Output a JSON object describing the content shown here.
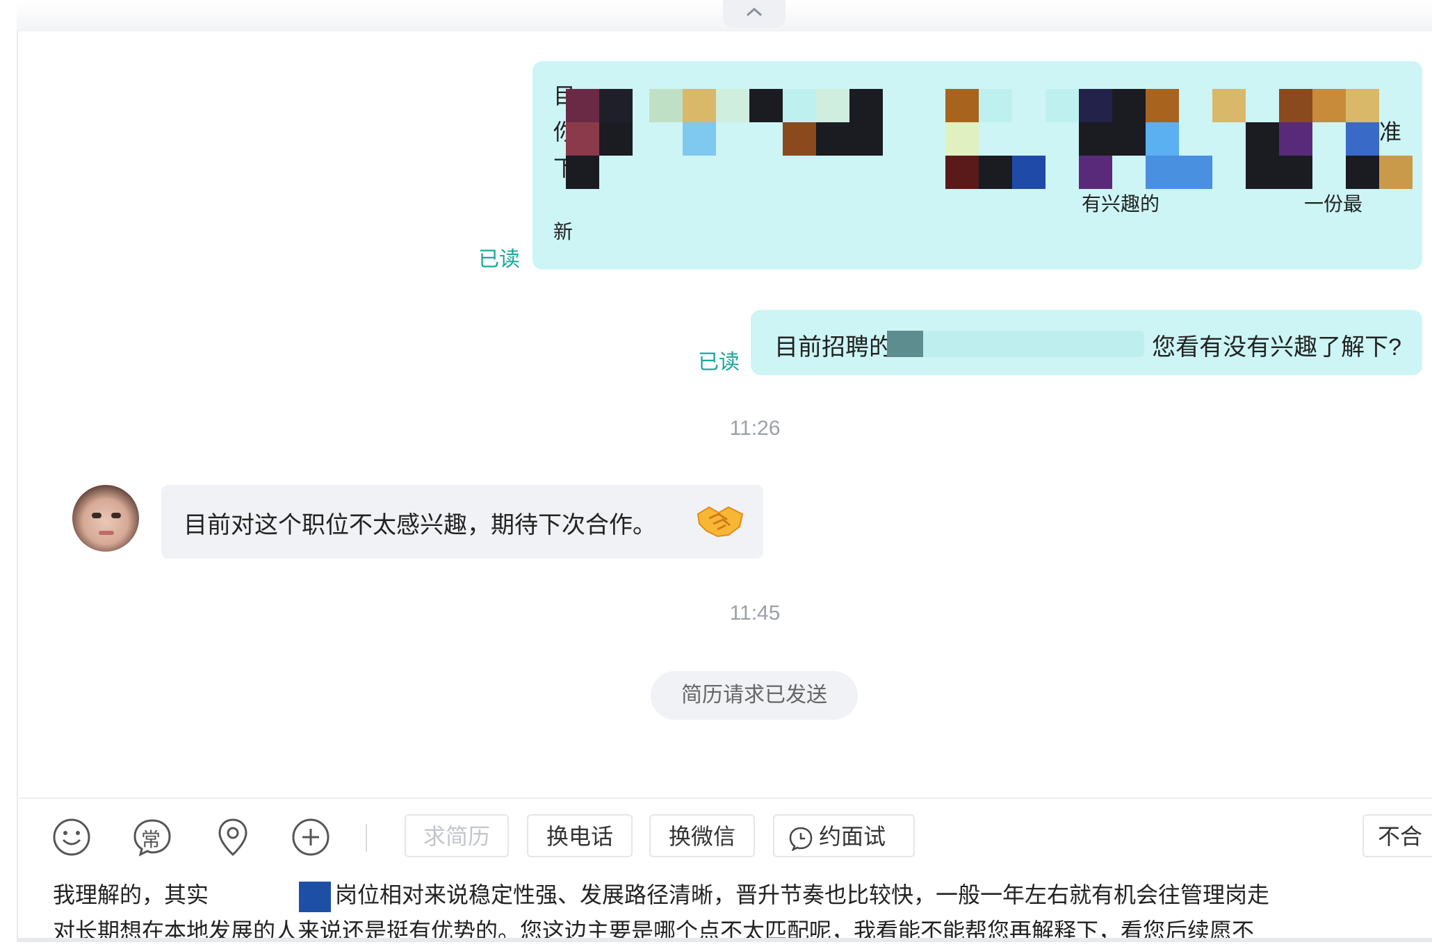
{
  "chat": {
    "message1": {
      "visible_fragments": [
        "目",
        "你",
        "标准",
        "下",
        "有兴趣的",
        "一份最",
        "新"
      ],
      "read_label": "已读"
    },
    "message2": {
      "prefix": "目前招聘的",
      "suffix": "您看有没有兴趣了解下?",
      "read_label": "已读"
    },
    "time1": "11:26",
    "incoming": {
      "text": "目前对这个职位不太感兴趣，期待下次合作。",
      "emoji": "handshake-emoji"
    },
    "time2": "11:45",
    "system_pill": "简历请求已发送"
  },
  "toolbar": {
    "icons": [
      "smile-icon",
      "common-phrases-icon",
      "location-icon",
      "add-icon"
    ],
    "common_label": "常",
    "buttons": {
      "request_resume": "求简历",
      "swap_phone": "换电话",
      "swap_wechat": "换微信",
      "schedule_interview": "约面试",
      "not_suitable": "不合"
    }
  },
  "composer": {
    "line1_a": "我理解的，其实",
    "line1_b": "岗位相对来说稳定性强、发展路径清晰，晋升节奏也比较快，一般一年左右就有机会往管理岗走",
    "line2": "对长期想在本地发展的人来说还是挺有优势的。您这边主要是哪个点不太匹配呢，我看能不能帮您再解释下，看您后续愿不"
  },
  "colors": {
    "outgoing_bubble": "#cdf5f5",
    "incoming_bubble": "#f1f2f5",
    "read_status": "#1aa79a"
  }
}
